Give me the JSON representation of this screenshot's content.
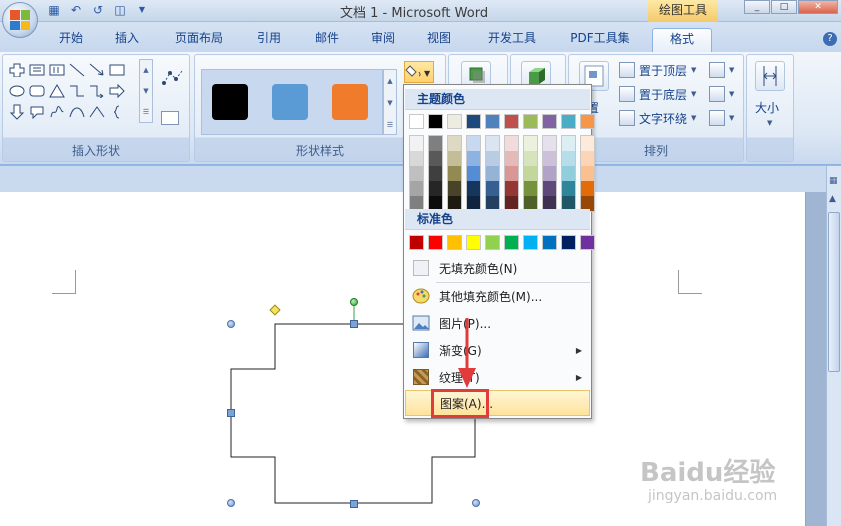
{
  "window": {
    "title": "文档 1 - Microsoft Word",
    "contextual_tab_title": "绘图工具"
  },
  "tabs": [
    {
      "label": "开始"
    },
    {
      "label": "插入"
    },
    {
      "label": "页面布局"
    },
    {
      "label": "引用"
    },
    {
      "label": "邮件"
    },
    {
      "label": "审阅"
    },
    {
      "label": "视图"
    },
    {
      "label": "开发工具"
    },
    {
      "label": "PDF工具集"
    },
    {
      "label": "格式",
      "active": true
    }
  ],
  "ribbon": {
    "insert_shapes_label": "插入形状",
    "shape_styles_label": "形状样式",
    "arrange_label": "排列",
    "bring_front": "置于顶层",
    "send_back": "置于底层",
    "text_wrap": "文字环绕",
    "position_partial": "置",
    "size_label": "大小",
    "style_swatches": [
      "#000000",
      "#5b9bd5",
      "#f07b2a"
    ]
  },
  "fill_menu": {
    "theme_colors_header": "主题颜色",
    "standard_colors_header": "标准色",
    "theme_base": [
      "#ffffff",
      "#000000",
      "#eeece1",
      "#1f497d",
      "#4f81bd",
      "#c0504d",
      "#9bbb59",
      "#8064a2",
      "#4bacc6",
      "#f79646"
    ],
    "theme_columns": [
      [
        "#f2f2f2",
        "#d8d8d8",
        "#bfbfbf",
        "#a5a5a5",
        "#7f7f7f"
      ],
      [
        "#7f7f7f",
        "#595959",
        "#3f3f3f",
        "#262626",
        "#0c0c0c"
      ],
      [
        "#ddd9c3",
        "#c4bd97",
        "#938953",
        "#494429",
        "#1d1b10"
      ],
      [
        "#c6d9f0",
        "#8db3e2",
        "#548dd4",
        "#17365d",
        "#0f243e"
      ],
      [
        "#dbe5f1",
        "#b8cce4",
        "#95b3d7",
        "#366092",
        "#244061"
      ],
      [
        "#f2dcdb",
        "#e5b9b7",
        "#d99694",
        "#953734",
        "#632423"
      ],
      [
        "#ebf1dd",
        "#d7e3bc",
        "#c3d69b",
        "#76923c",
        "#4f6128"
      ],
      [
        "#e5e0ec",
        "#ccc1d9",
        "#b2a2c7",
        "#5f497a",
        "#3f3151"
      ],
      [
        "#dbeef3",
        "#b7dde8",
        "#92cddc",
        "#31859b",
        "#205867"
      ],
      [
        "#fdeada",
        "#fbd5b5",
        "#fac08f",
        "#e36c09",
        "#974806"
      ]
    ],
    "standard_colors": [
      "#c00000",
      "#ff0000",
      "#ffc000",
      "#ffff00",
      "#92d050",
      "#00b050",
      "#00b0f0",
      "#0070c0",
      "#002060",
      "#7030a0"
    ],
    "items": {
      "no_fill": "无填充颜色(N)",
      "more_colors": "其他填充颜色(M)...",
      "picture": "图片(P)...",
      "gradient": "渐变(G)",
      "texture": "纹理(T)",
      "pattern": "图案(A)..."
    }
  },
  "watermark": {
    "brand": "Baidu经验",
    "url": "jingyan.baidu.com"
  }
}
